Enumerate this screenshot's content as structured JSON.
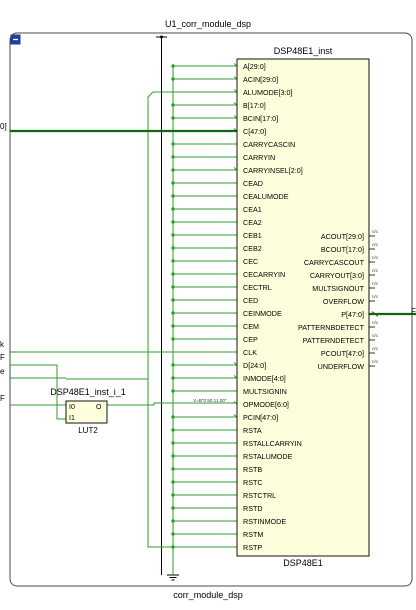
{
  "top_title": "U1_corr_module_dsp",
  "bottom_title": "corr_module_dsp",
  "collapse_symbol": "−",
  "dsp": {
    "instance_name": "DSP48E1_inst",
    "type_name": "DSP48E1",
    "left_pins": [
      "A[29:0]",
      "ACIN[29:0]",
      "ALUMODE[3:0]",
      "B[17:0]",
      "BCIN[17:0]",
      "C[47:0]",
      "CARRYCASCIN",
      "CARRYIN",
      "CARRYINSEL[2:0]",
      "CEAD",
      "CEALUMODE",
      "CEA1",
      "CEA2",
      "CEB1",
      "CEB2",
      "CEC",
      "CECARRYIN",
      "CECTRL",
      "CED",
      "CEINMODE",
      "CEM",
      "CEP",
      "CLK",
      "D[24:0]",
      "INMODE[4:0]",
      "MULTSIGNIN",
      "OPMODE[6:0]",
      "PCIN[47:0]",
      "RSTA",
      "RSTALLCARRYIN",
      "RSTALUMODE",
      "RSTB",
      "RSTC",
      "RSTCTRL",
      "RSTD",
      "RSTINMODE",
      "RSTM",
      "RSTP"
    ],
    "right_pins": [
      {
        "name": "ACOUT[29:0]",
        "nc": true
      },
      {
        "name": "BCOUT[17:0]",
        "nc": true
      },
      {
        "name": "CARRYCASCOUT",
        "nc": true
      },
      {
        "name": "CARRYOUT[3:0]",
        "nc": true
      },
      {
        "name": "MULTSIGNOUT",
        "nc": true
      },
      {
        "name": "OVERFLOW",
        "nc": true
      },
      {
        "name": "P[47:0]",
        "nc": false
      },
      {
        "name": "PATTERNBDETECT",
        "nc": true
      },
      {
        "name": "PATTERNDETECT",
        "nc": true
      },
      {
        "name": "PCOUT[47:0]",
        "nc": true
      },
      {
        "name": "UNDERFLOW",
        "nc": true
      }
    ],
    "nc_label": "n/c",
    "opmode_const": "V=B\"0 50 11 00\""
  },
  "lut": {
    "instance_name": "DSP48E1_inst_i_1",
    "type_name": "LUT2",
    "in_pins": [
      "I0",
      "I1"
    ],
    "out_pin": "O"
  },
  "ports": {
    "left_labels": [
      "0]",
      "k",
      "F",
      "e",
      "F"
    ],
    "right_label": "F"
  }
}
